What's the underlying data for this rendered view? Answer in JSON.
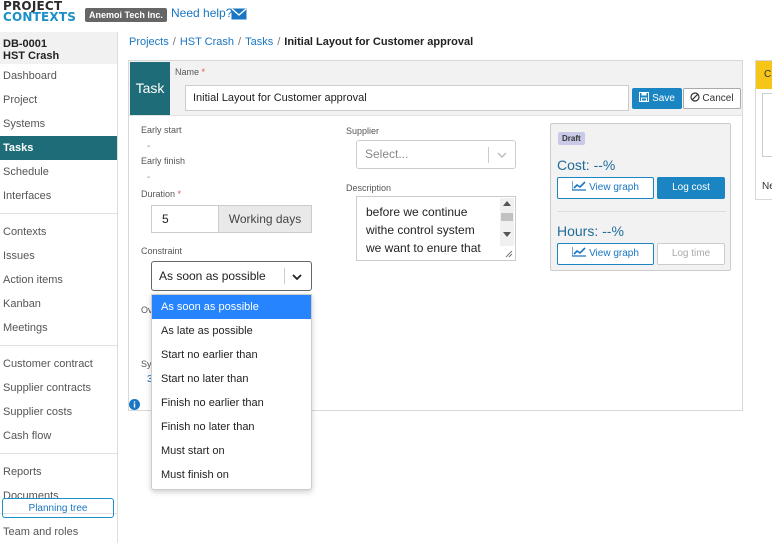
{
  "header": {
    "logo_line1": "PROJECT",
    "logo_line2": "CONTEXTS",
    "org": "Anemoi Tech Inc.",
    "help": "Need help?"
  },
  "sidebar": {
    "project_id": "DB-0001",
    "project_name": "HST Crash",
    "groups": [
      [
        "Dashboard",
        "Project",
        "Systems",
        "Tasks",
        "Schedule",
        "Interfaces"
      ],
      [
        "Contexts",
        "Issues",
        "Action items",
        "Kanban",
        "Meetings"
      ],
      [
        "Customer contract",
        "Supplier contracts",
        "Supplier costs",
        "Cash flow"
      ],
      [
        "Reports",
        "Documents"
      ],
      [
        "Team and roles"
      ]
    ],
    "active": "Tasks",
    "planning_tree": "Planning tree"
  },
  "breadcrumb": {
    "items": [
      "Projects",
      "HST Crash",
      "Tasks"
    ],
    "current": "Initial Layout for Customer approval"
  },
  "task": {
    "tag": "Task",
    "name_label": "Name",
    "name_value": "Initial Layout for Customer approval",
    "save": "Save",
    "cancel": "Cancel",
    "early_start_label": "Early start",
    "early_start_value": "-",
    "early_finish_label": "Early finish",
    "early_finish_value": "-",
    "duration_label": "Duration",
    "duration_value": "5",
    "duration_unit": "Working days",
    "constraint_label": "Constraint",
    "constraint_value": "As soon as possible",
    "owner_label_partial": "Ov",
    "sys_label_partial": "Sy",
    "sys_value_partial": "3",
    "supplier_label": "Supplier",
    "supplier_placeholder": "Select...",
    "description_label": "Description",
    "description_lines": [
      "before we continue",
      "withe control system",
      "we  want to enure that",
      "..."
    ]
  },
  "status_panel": {
    "badge": "Draft",
    "cost": "Cost: --%",
    "hours": "Hours: --%",
    "view_graph": "View graph",
    "log_cost": "Log cost",
    "log_time": "Log time"
  },
  "constraint_options": [
    "As soon as possible",
    "As late as possible",
    "Start no earlier than",
    "Start no later than",
    "Finish no earlier than",
    "Finish no later than",
    "Must start on",
    "Must finish on"
  ],
  "constraint_selected_index": 0,
  "right_panel": {
    "header_partial": "C",
    "text_partial": "Ne"
  },
  "colors": {
    "accent": "#1f6c79",
    "primary_button": "#1a85c2",
    "selected_option": "#2684ff",
    "draft_badge": "#c9c9e8"
  }
}
